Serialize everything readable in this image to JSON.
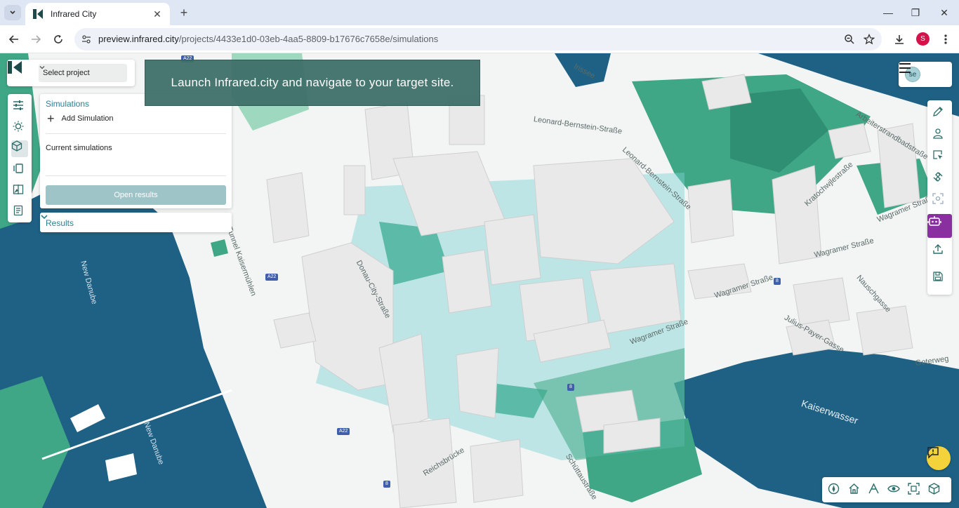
{
  "browser": {
    "tab_title": "Infrared City",
    "url_host": "preview.infrared.city",
    "url_path": "/projects/4433e1d0-03eb-4aa5-8809-b17676c7658e/simulations",
    "profile_initial": "S"
  },
  "app": {
    "select_project_label": "Select project",
    "banner_text": "Launch Infrared.city and navigate to your target site.",
    "user_initials": "se",
    "simulations": {
      "title": "Simulations",
      "add_label": "Add Simulation",
      "current_label": "Current simulations",
      "open_results_label": "Open results"
    },
    "results_label": "Results",
    "colors": {
      "water": "#1f6184",
      "green": "#3fa786",
      "accent": "#8a2f9f",
      "panel_title": "#2d7f94",
      "banner": "#3f706a",
      "help": "#f3d23a"
    },
    "left_tools": [
      "sliders-icon",
      "sun-icon",
      "cube-icon",
      "panels-icon",
      "compare-icon",
      "document-icon"
    ],
    "right_tools": [
      "pencil-icon",
      "user-pin-icon",
      "select-icon",
      "satellite-icon",
      "focus-icon",
      "robot-icon",
      "upload-icon",
      "save-icon"
    ],
    "bottom_tools": [
      "compass-icon",
      "home-icon",
      "angle-icon",
      "eye-icon",
      "frame-icon",
      "cube-icon"
    ]
  },
  "map": {
    "labels": {
      "irissee": "Irissee",
      "leonard1": "Leonard-Bernstein-Straße",
      "leonard2": "Leonard-Bernstein-Straße",
      "arbeiter": "Arbeiterstrandbadstraße",
      "kratochwjle": "Kratochwjlestraße",
      "wagramer1": "Wagramer Straße",
      "wagramer2": "Wagramer Straße",
      "wagramer3": "Wagramer Straße",
      "wagramer4": "Wagramer Straße",
      "tunnel": "Tunnel Kaisermühlen",
      "donaucity": "Donau-City-Straße",
      "newdanube1": "New Danube",
      "newdanube2": "New Danube",
      "kaiserwasser": "Kaiserwasser",
      "nauschgasse": "Nauschgasse",
      "juliuspayer": "Julius-Payer-Gasse",
      "goterweg": "Goterweg",
      "reichsbrucke": "Reichsbrücke",
      "schutt": "Schüttaustraße"
    },
    "shields": {
      "a22a": "A22",
      "a22b": "A22",
      "a22c": "A22",
      "n8a": "8",
      "n8b": "8",
      "n8c": "8"
    }
  }
}
